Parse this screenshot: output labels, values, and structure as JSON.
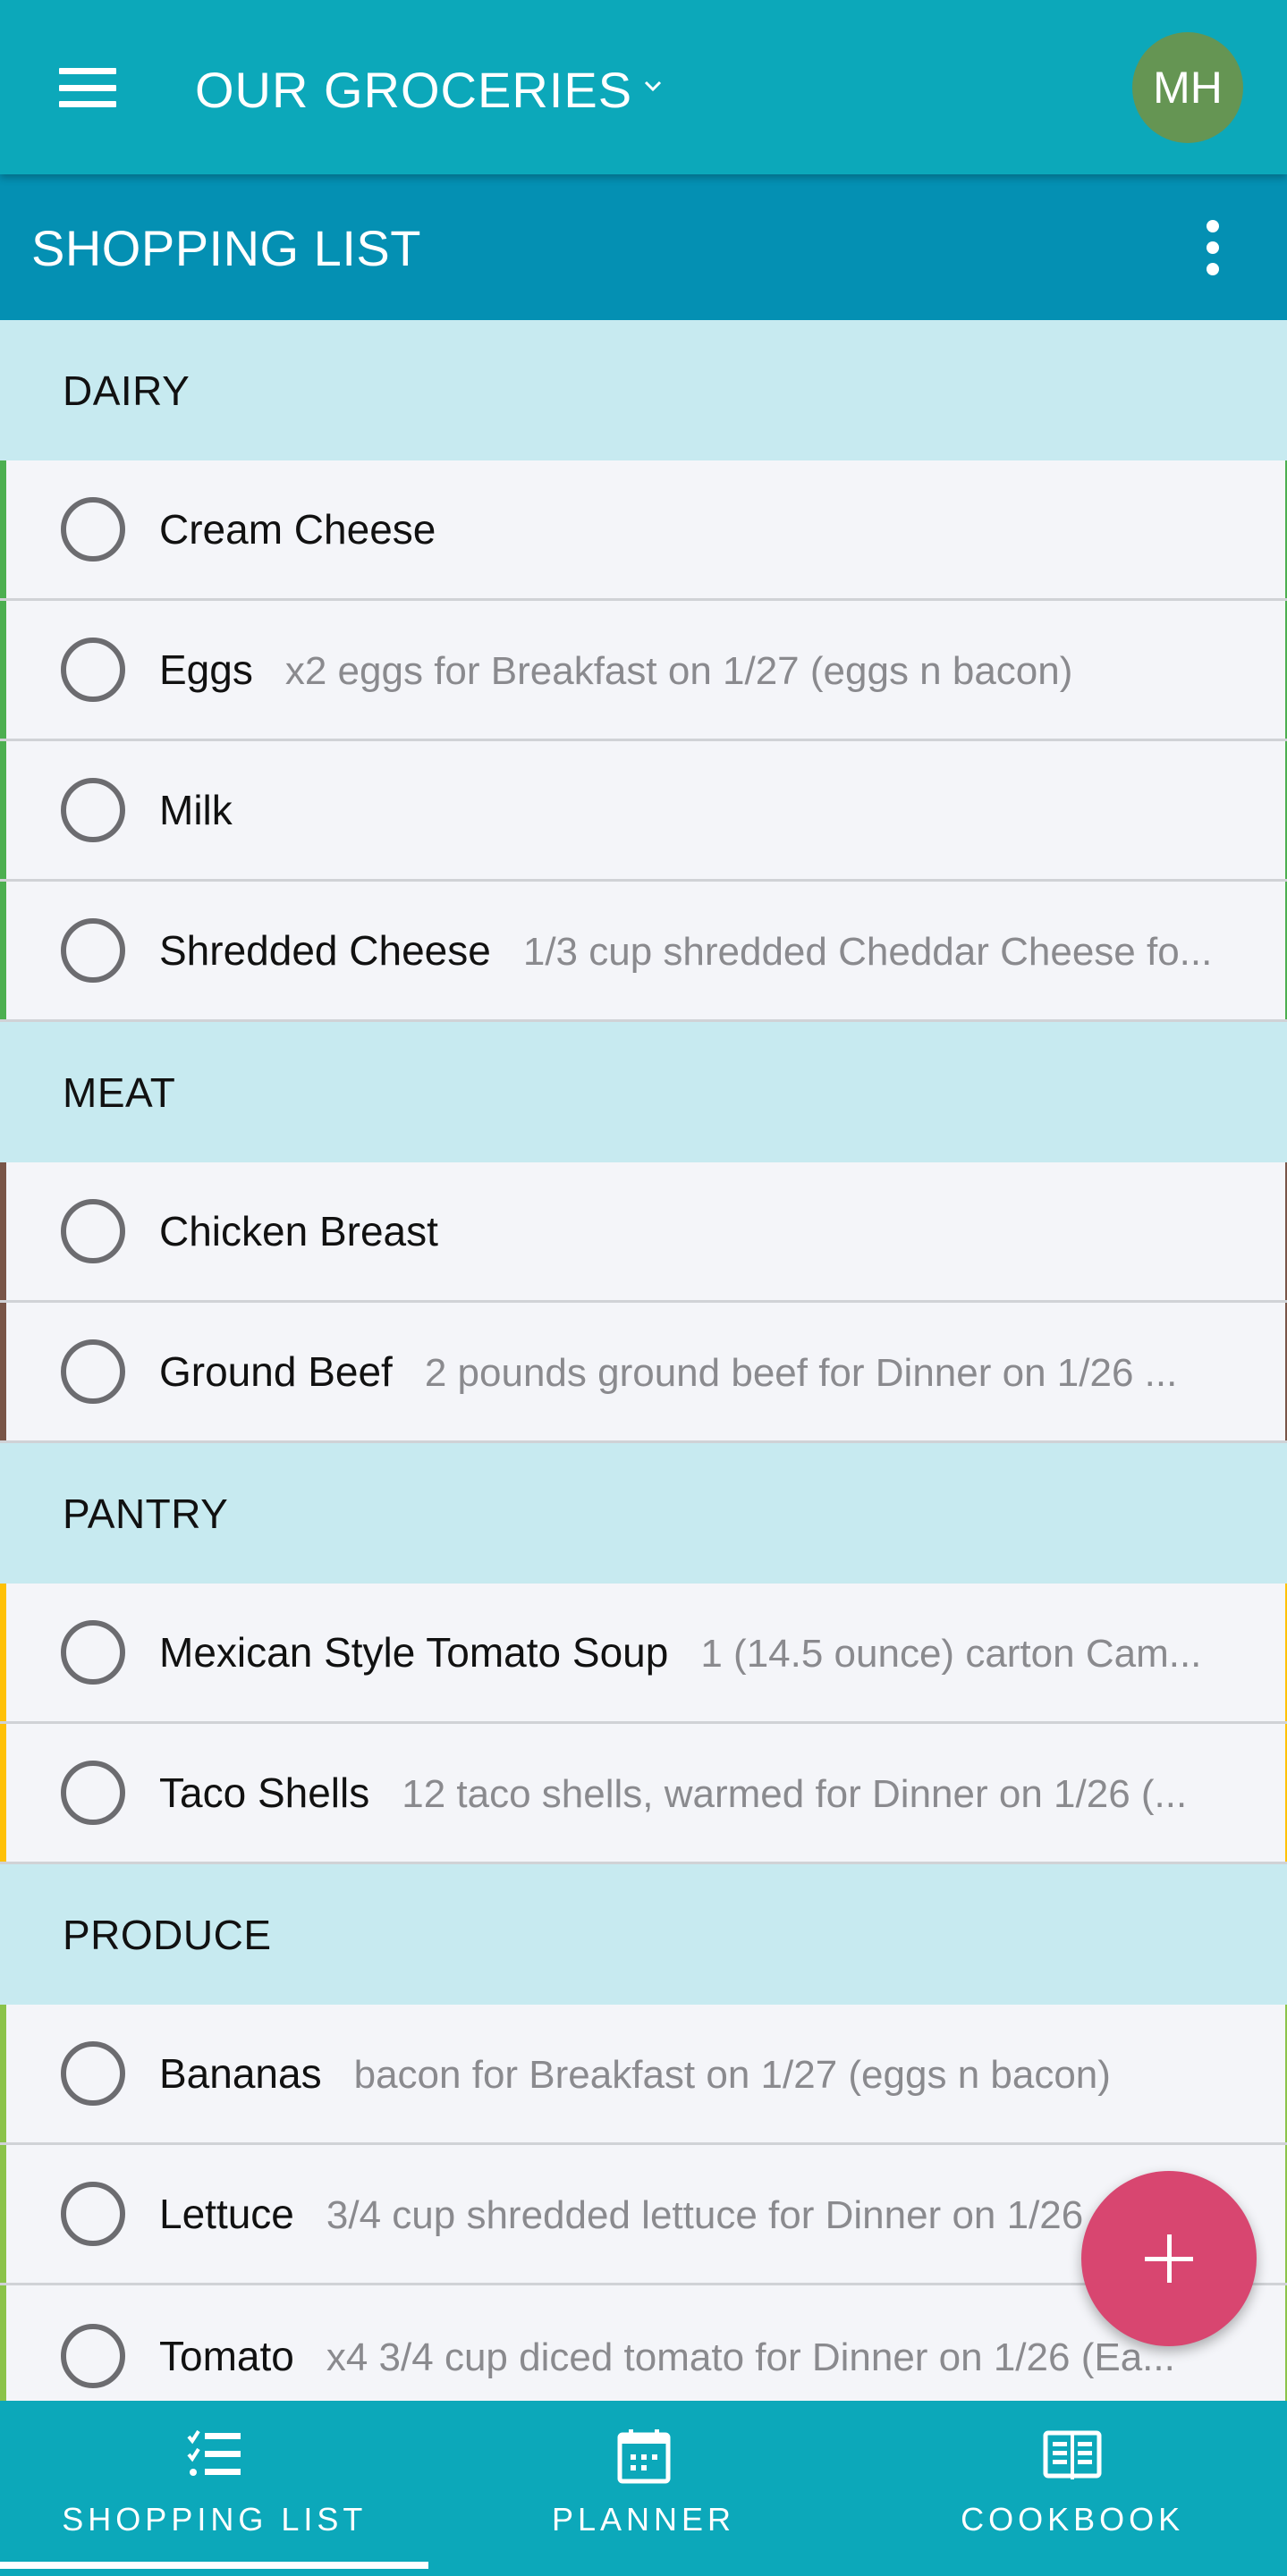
{
  "header": {
    "title": "OUR GROCERIES",
    "avatar_initials": "MH",
    "menu_icon": "hamburger-menu-icon",
    "dropdown_icon": "chevron-down-icon"
  },
  "subheader": {
    "title": "SHOPPING LIST",
    "more_icon": "more-vertical-icon"
  },
  "categories": [
    {
      "name": "DAIRY",
      "color": "#4caf50",
      "items": [
        {
          "name": "Cream Cheese",
          "note": ""
        },
        {
          "name": "Eggs",
          "note": "x2 eggs for Breakfast on 1/27 (eggs n bacon)"
        },
        {
          "name": "Milk",
          "note": ""
        },
        {
          "name": "Shredded Cheese",
          "note": "1/3 cup shredded Cheddar Cheese fo..."
        }
      ]
    },
    {
      "name": "MEAT",
      "color": "#795548",
      "items": [
        {
          "name": "Chicken Breast",
          "note": ""
        },
        {
          "name": "Ground Beef",
          "note": "2 pounds ground beef for Dinner on 1/26 ..."
        }
      ]
    },
    {
      "name": "PANTRY",
      "color": "#ffc107",
      "items": [
        {
          "name": "Mexican Style Tomato Soup",
          "note": "1 (14.5 ounce) carton Cam..."
        },
        {
          "name": "Taco Shells",
          "note": "12 taco shells, warmed for Dinner on 1/26 (..."
        }
      ]
    },
    {
      "name": "PRODUCE",
      "color": "#8bc34a",
      "items": [
        {
          "name": "Bananas",
          "note": "bacon for Breakfast on 1/27 (eggs n bacon)"
        },
        {
          "name": "Lettuce",
          "note": "3/4 cup shredded lettuce for Dinner on 1/26"
        },
        {
          "name": "Tomato",
          "note": "x4 3/4 cup diced tomato for Dinner on 1/26 (Ea..."
        }
      ]
    }
  ],
  "fab": {
    "icon": "plus-icon",
    "color": "#d84670"
  },
  "bottom_nav": {
    "tabs": [
      {
        "label": "SHOPPING LIST",
        "icon": "checklist-icon",
        "active": true
      },
      {
        "label": "PLANNER",
        "icon": "calendar-icon",
        "active": false
      },
      {
        "label": "COOKBOOK",
        "icon": "open-book-icon",
        "active": false
      }
    ]
  },
  "colors": {
    "appbar": "#0ca8ba",
    "subbar": "#0490b3",
    "category_header_bg": "#c7eaf0",
    "avatar_bg": "#659553"
  }
}
